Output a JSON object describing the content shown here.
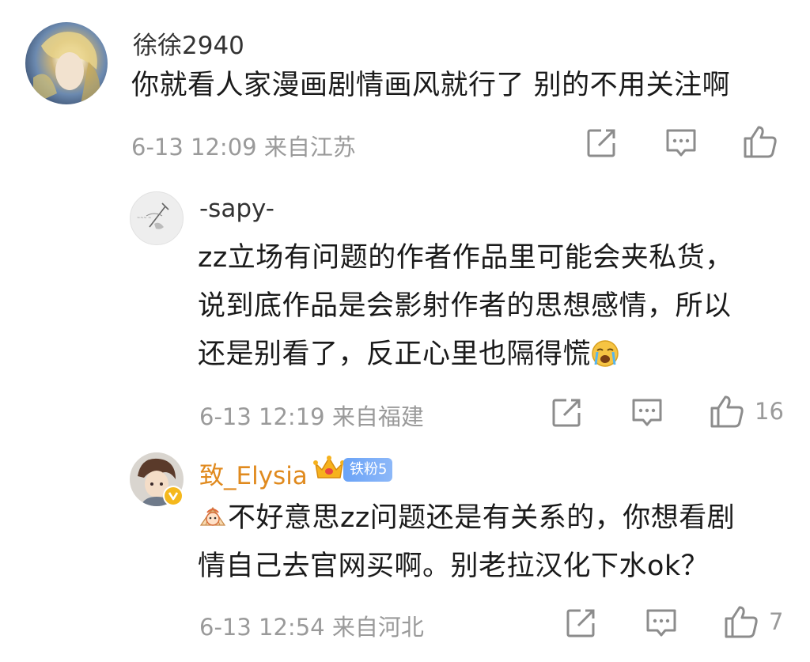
{
  "comments": [
    {
      "username": "徐徐2940",
      "text": "你就看人家漫画剧情画风就行了 别的不用关注啊",
      "meta": "6-13 12:09  来自江苏",
      "likes": ""
    },
    {
      "username": "-sapy-",
      "text_lines": [
        "zz立场有问题的作者作品里可能会夹私货，",
        "说到底作品是会影射作者的思想感情，所以",
        "还是别看了，反正心里也隔得慌"
      ],
      "meta": "6-13 12:19  来自福建",
      "likes": "16"
    },
    {
      "username": "致_Elysia",
      "fan_badge": "铁粉5",
      "text_lines": [
        "不好意思zz问题还是有关系的，你想看剧",
        "情自己去官网买啊。别老拉汉化下水ok？"
      ],
      "meta": "6-13 12:54  来自河北",
      "likes": "7"
    }
  ],
  "icons": {
    "share": "share-icon",
    "reply": "comment-icon",
    "like": "thumbs-up-icon",
    "crying_emoji": "crying-emoji-icon",
    "fan_emoji": "fan-emoji-icon",
    "crown": "crown-icon"
  },
  "colors": {
    "username_highlight": "#e08a1e",
    "meta_gray": "#9a9a9a",
    "fan_badge": "#6aa3f7"
  }
}
